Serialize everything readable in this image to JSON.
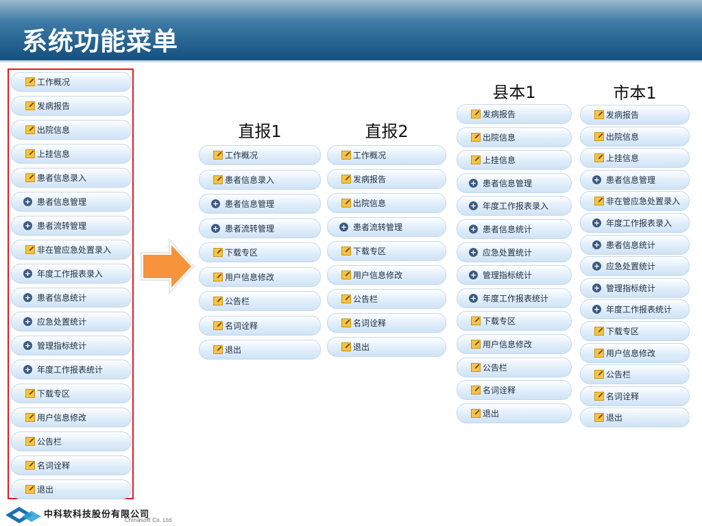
{
  "title": "系统功能菜单",
  "colors": {
    "title_bar": "#13507f",
    "highlight_border": "#e3171c",
    "arrow": "#f7933b"
  },
  "icons": {
    "note": "note-edit-icon",
    "plus": "plus-circle-icon"
  },
  "left_menu": [
    {
      "label": "工作概况",
      "icon": "note"
    },
    {
      "label": "发病报告",
      "icon": "note"
    },
    {
      "label": "出院信息",
      "icon": "note"
    },
    {
      "label": "上挂信息",
      "icon": "note"
    },
    {
      "label": "患者信息录入",
      "icon": "note"
    },
    {
      "label": "患者信息管理",
      "icon": "plus"
    },
    {
      "label": "患者流转管理",
      "icon": "plus"
    },
    {
      "label": "非在管应急处置录入",
      "icon": "note"
    },
    {
      "label": "年度工作报表录入",
      "icon": "plus"
    },
    {
      "label": "患者信息统计",
      "icon": "plus"
    },
    {
      "label": "应急处置统计",
      "icon": "plus"
    },
    {
      "label": "管理指标统计",
      "icon": "plus"
    },
    {
      "label": "年度工作报表统计",
      "icon": "plus"
    },
    {
      "label": "下载专区",
      "icon": "note"
    },
    {
      "label": "用户信息修改",
      "icon": "note"
    },
    {
      "label": "公告栏",
      "icon": "note"
    },
    {
      "label": "名词诠释",
      "icon": "note"
    },
    {
      "label": "退出",
      "icon": "note"
    }
  ],
  "columns": [
    {
      "heading": "直报1",
      "items": [
        {
          "label": "工作概况",
          "icon": "note"
        },
        {
          "label": "患者信息录入",
          "icon": "note"
        },
        {
          "label": "患者信息管理",
          "icon": "plus"
        },
        {
          "label": "患者流转管理",
          "icon": "plus"
        },
        {
          "label": "下载专区",
          "icon": "note"
        },
        {
          "label": "用户信息修改",
          "icon": "note"
        },
        {
          "label": "公告栏",
          "icon": "note"
        },
        {
          "label": "名词诠释",
          "icon": "note"
        },
        {
          "label": "退出",
          "icon": "note"
        }
      ]
    },
    {
      "heading": "直报2",
      "items": [
        {
          "label": "工作概况",
          "icon": "note"
        },
        {
          "label": "发病报告",
          "icon": "note"
        },
        {
          "label": "出院信息",
          "icon": "note"
        },
        {
          "label": "患者流转管理",
          "icon": "plus"
        },
        {
          "label": "下载专区",
          "icon": "note"
        },
        {
          "label": "用户信息修改",
          "icon": "note"
        },
        {
          "label": "公告栏",
          "icon": "note"
        },
        {
          "label": "名词诠释",
          "icon": "note"
        },
        {
          "label": "退出",
          "icon": "note"
        }
      ]
    },
    {
      "heading": "县本1",
      "items": [
        {
          "label": "发病报告",
          "icon": "note"
        },
        {
          "label": "出院信息",
          "icon": "note"
        },
        {
          "label": "上挂信息",
          "icon": "note"
        },
        {
          "label": "患者信息管理",
          "icon": "plus"
        },
        {
          "label": "年度工作报表录入",
          "icon": "plus"
        },
        {
          "label": "患者信息统计",
          "icon": "plus"
        },
        {
          "label": "应急处置统计",
          "icon": "plus"
        },
        {
          "label": "管理指标统计",
          "icon": "plus"
        },
        {
          "label": "年度工作报表统计",
          "icon": "plus"
        },
        {
          "label": "下载专区",
          "icon": "note"
        },
        {
          "label": "用户信息修改",
          "icon": "note"
        },
        {
          "label": "公告栏",
          "icon": "note"
        },
        {
          "label": "名词诠释",
          "icon": "note"
        },
        {
          "label": "退出",
          "icon": "note"
        }
      ]
    },
    {
      "heading": "市本1",
      "items": [
        {
          "label": "发病报告",
          "icon": "note"
        },
        {
          "label": "出院信息",
          "icon": "note"
        },
        {
          "label": "上挂信息",
          "icon": "note"
        },
        {
          "label": "患者信息管理",
          "icon": "plus"
        },
        {
          "label": "非在管应急处置录入",
          "icon": "note"
        },
        {
          "label": "年度工作报表录入",
          "icon": "plus"
        },
        {
          "label": "患者信息统计",
          "icon": "plus"
        },
        {
          "label": "应急处置统计",
          "icon": "plus"
        },
        {
          "label": "管理指标统计",
          "icon": "plus"
        },
        {
          "label": "年度工作报表统计",
          "icon": "plus"
        },
        {
          "label": "下载专区",
          "icon": "note"
        },
        {
          "label": "用户信息修改",
          "icon": "note"
        },
        {
          "label": "公告栏",
          "icon": "note"
        },
        {
          "label": "名词诠释",
          "icon": "note"
        },
        {
          "label": "退出",
          "icon": "note"
        }
      ]
    }
  ],
  "footer": {
    "company_cn": "中科软科技股份有限公司",
    "company_en": "Chinasoft Co. Ltd"
  }
}
